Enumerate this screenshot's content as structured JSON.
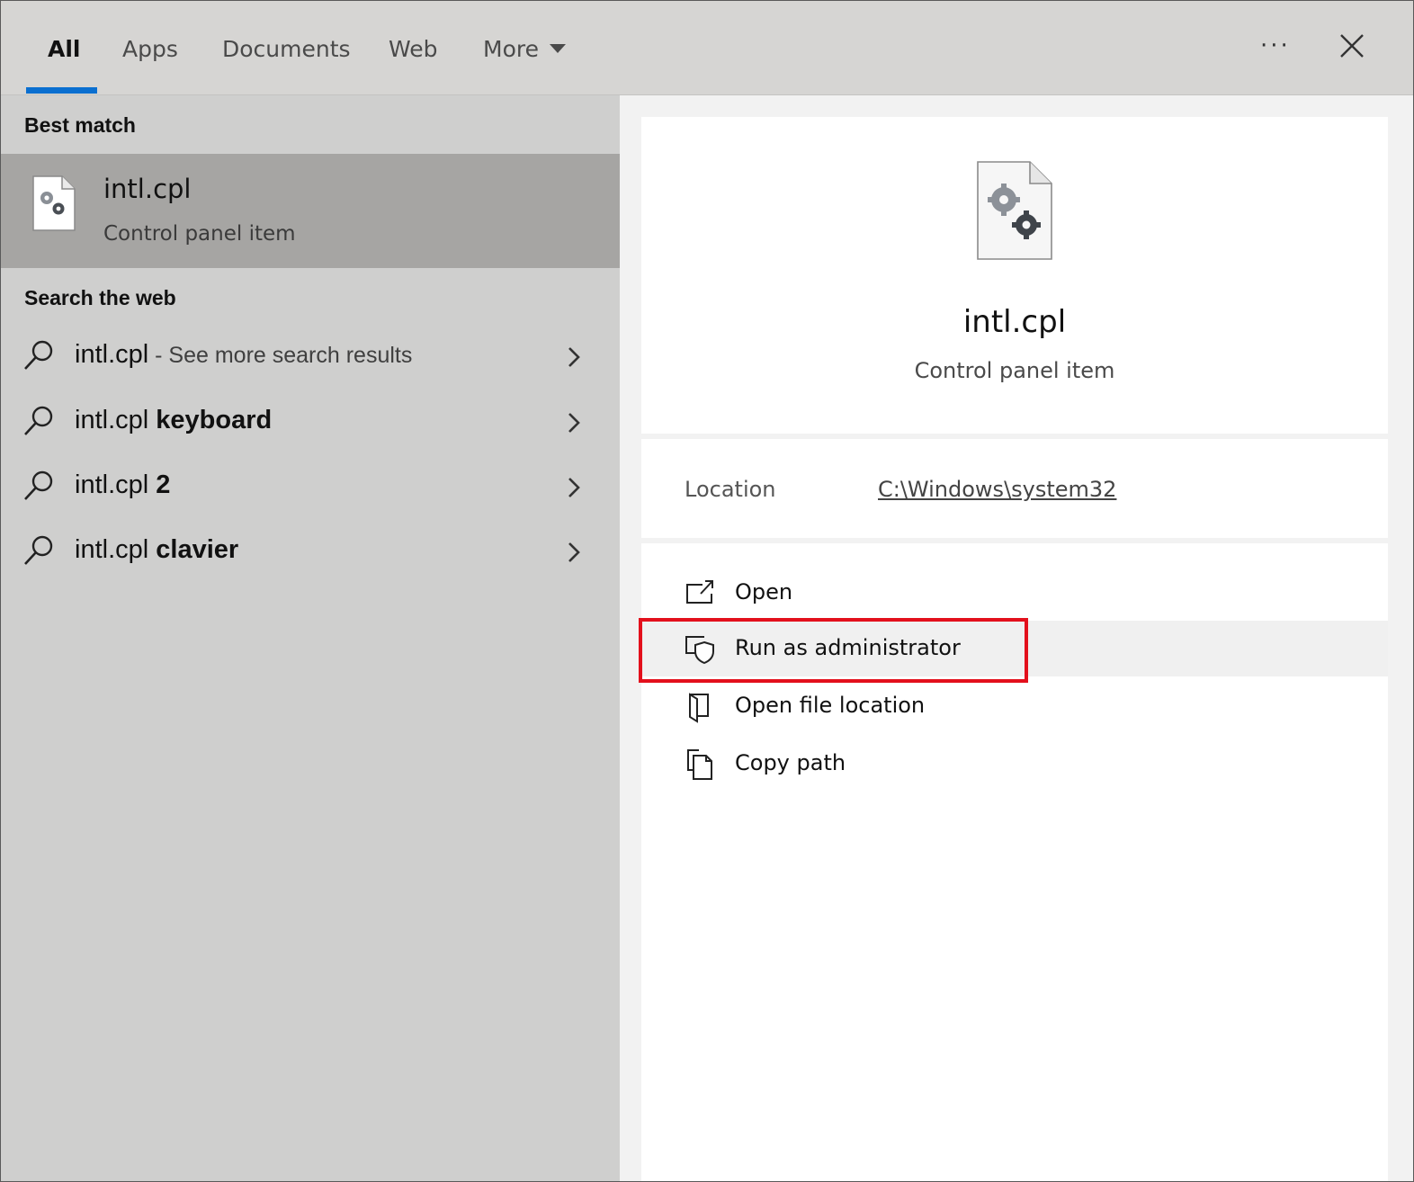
{
  "tabs": [
    {
      "label": "All",
      "active": true
    },
    {
      "label": "Apps"
    },
    {
      "label": "Documents"
    },
    {
      "label": "Web"
    },
    {
      "label": "More"
    }
  ],
  "accent_color": "#0a6fd0",
  "highlight_color": "#e3101c",
  "best_match": {
    "header": "Best match",
    "title": "intl.cpl",
    "subtitle": "Control panel item",
    "icon": "control-panel-file-icon"
  },
  "search_web": {
    "header": "Search the web",
    "items": [
      {
        "prefix": "intl.cpl",
        "bold": "",
        "suffix": " - See more search results"
      },
      {
        "prefix": "intl.cpl ",
        "bold": "keyboard",
        "suffix": ""
      },
      {
        "prefix": "intl.cpl ",
        "bold": "2",
        "suffix": ""
      },
      {
        "prefix": "intl.cpl ",
        "bold": "clavier",
        "suffix": ""
      }
    ]
  },
  "preview": {
    "title": "intl.cpl",
    "subtitle": "Control panel item",
    "location_label": "Location",
    "location_value": "C:\\Windows\\system32"
  },
  "actions": [
    {
      "label": "Open",
      "icon": "open-icon"
    },
    {
      "label": "Run as administrator",
      "icon": "shield-icon",
      "highlighted": true
    },
    {
      "label": "Open file location",
      "icon": "folder-icon"
    },
    {
      "label": "Copy path",
      "icon": "copy-icon"
    }
  ]
}
